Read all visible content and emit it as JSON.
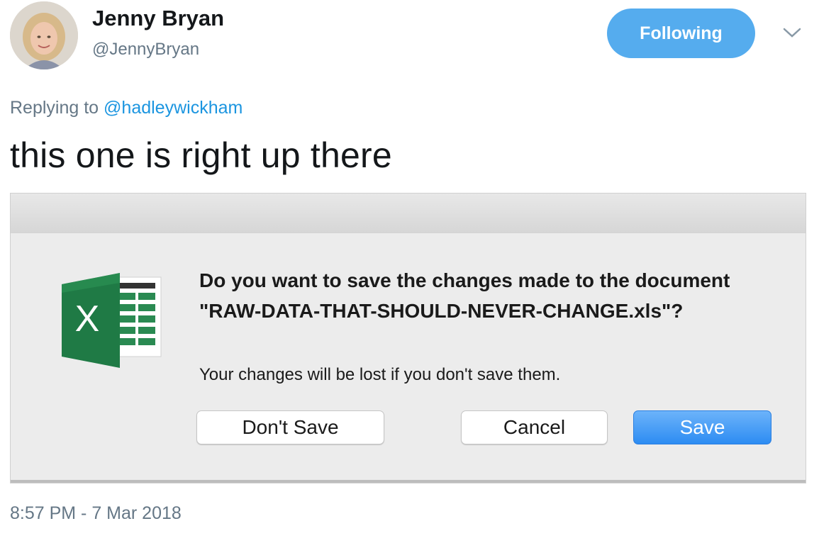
{
  "author": {
    "name": "Jenny Bryan",
    "handle": "@JennyBryan",
    "avatar_icon": "profile-photo"
  },
  "follow_button": {
    "label": "Following",
    "color": "#55acee"
  },
  "more_icon": "chevron-down-icon",
  "reply": {
    "prefix": "Replying to",
    "mention": "@hadleywickham"
  },
  "tweet_text": "this one is right up there",
  "dialog": {
    "app_icon": "excel-icon",
    "app_icon_letter": "X",
    "title": "Do you want to save the changes made to the document \"RAW-DATA-THAT-SHOULD-NEVER-CHANGE.xls\"?",
    "message": "Your changes will be lost if you don't save them.",
    "buttons": {
      "dont_save": "Don't Save",
      "cancel": "Cancel",
      "save": "Save"
    },
    "primary_color": "#2d8cf2"
  },
  "timestamp": "8:57 PM - 7 Mar 2018"
}
